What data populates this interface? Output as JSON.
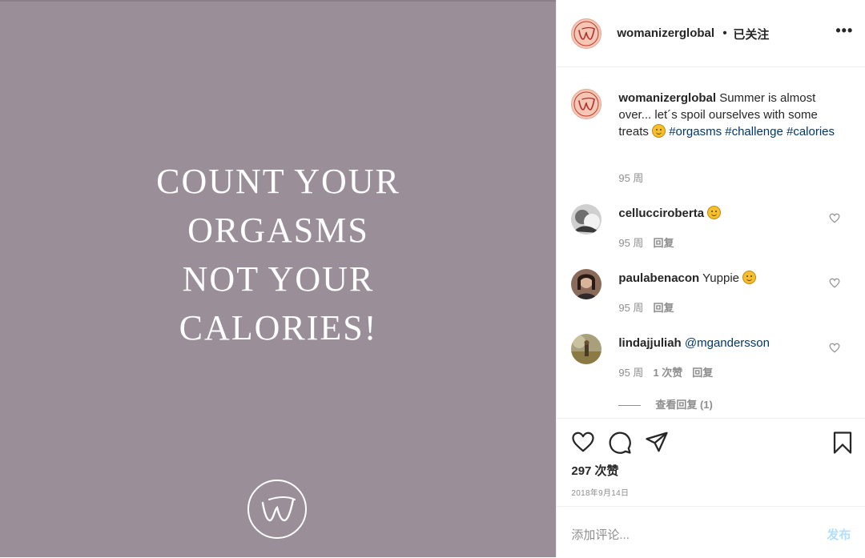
{
  "media": {
    "quote_lines": [
      "COUNT YOUR",
      "ORGASMS",
      "NOT YOUR",
      "CALORIES!"
    ],
    "background_color": "#9a8f98",
    "logo_icon": "womanizer-w-logo-icon"
  },
  "header": {
    "username": "womanizerglobal",
    "separator": "•",
    "follow_status": "已关注",
    "more_label": "•••"
  },
  "caption": {
    "username": "womanizerglobal",
    "text": " Summer is almost over... let´s spoil ourselves with some treats ",
    "emoji": "smiling-face-icon",
    "hashtags": [
      "#orgasms",
      "#challenge",
      "#calories"
    ],
    "time": "95 周"
  },
  "comments": [
    {
      "username": "cellucciroberta",
      "text": "",
      "emoji": "smiling-face-icon",
      "time": "95 周",
      "likes": "",
      "reply": "回复"
    },
    {
      "username": "paulabenacon",
      "text": "Yuppie",
      "emoji": "smiling-face-icon",
      "time": "95 周",
      "likes": "",
      "reply": "回复"
    },
    {
      "username": "lindajjuliah",
      "text": "@mgandersson",
      "emoji": "",
      "time": "95 周",
      "likes": "1 次赞",
      "reply": "回复"
    }
  ],
  "view_replies": "查看回复 (1)",
  "likes": "297 次赞",
  "date": "2018年9月14日",
  "add_comment": {
    "placeholder": "添加评论...",
    "post_label": "发布"
  },
  "colors": {
    "link": "#00376b",
    "muted": "#8e8e8e",
    "post_button": "#b2dffc"
  }
}
